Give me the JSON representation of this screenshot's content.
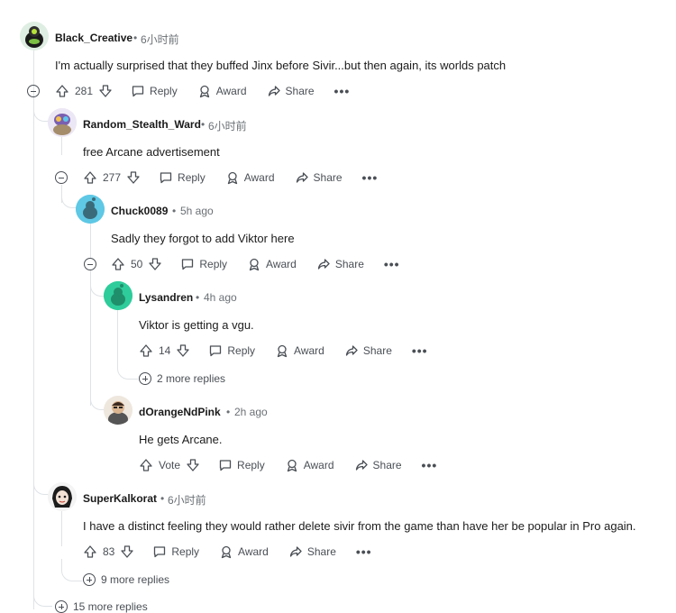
{
  "comments": [
    {
      "username": "Black_Creative",
      "time": "6小时前",
      "text": "I'm actually surprised that they buffed Jinx before Sivir...but then again, its worlds patch",
      "votes": "281"
    },
    {
      "username": "Random_Stealth_Ward",
      "time": "6小时前",
      "text": "free Arcane advertisement",
      "votes": "277"
    },
    {
      "username": "Chuck0089",
      "time": "5h ago",
      "text": "Sadly they forgot to add Viktor here",
      "votes": "50"
    },
    {
      "username": "Lysandren",
      "time": "4h ago",
      "text": "Viktor is getting a vgu.",
      "votes": "14"
    },
    {
      "username": "dOrangeNdPink",
      "time": "2h ago",
      "text": "He gets Arcane.",
      "votes": "Vote"
    },
    {
      "username": "SuperKalkorat",
      "time": "6小时前",
      "text": "I have a distinct feeling they would rather delete sivir from the game than have her be popular in Pro again.",
      "votes": "83"
    }
  ],
  "actions": {
    "reply": "Reply",
    "award": "Award",
    "share": "Share",
    "more": "•••",
    "separator": "•"
  },
  "more_replies": {
    "lysandren": "2 more replies",
    "superkalkorat": "9 more replies",
    "top": "15 more replies"
  },
  "colors": {
    "thread": "#dfe3e6",
    "text": "#1c1c1c",
    "meta": "#6b7075"
  }
}
